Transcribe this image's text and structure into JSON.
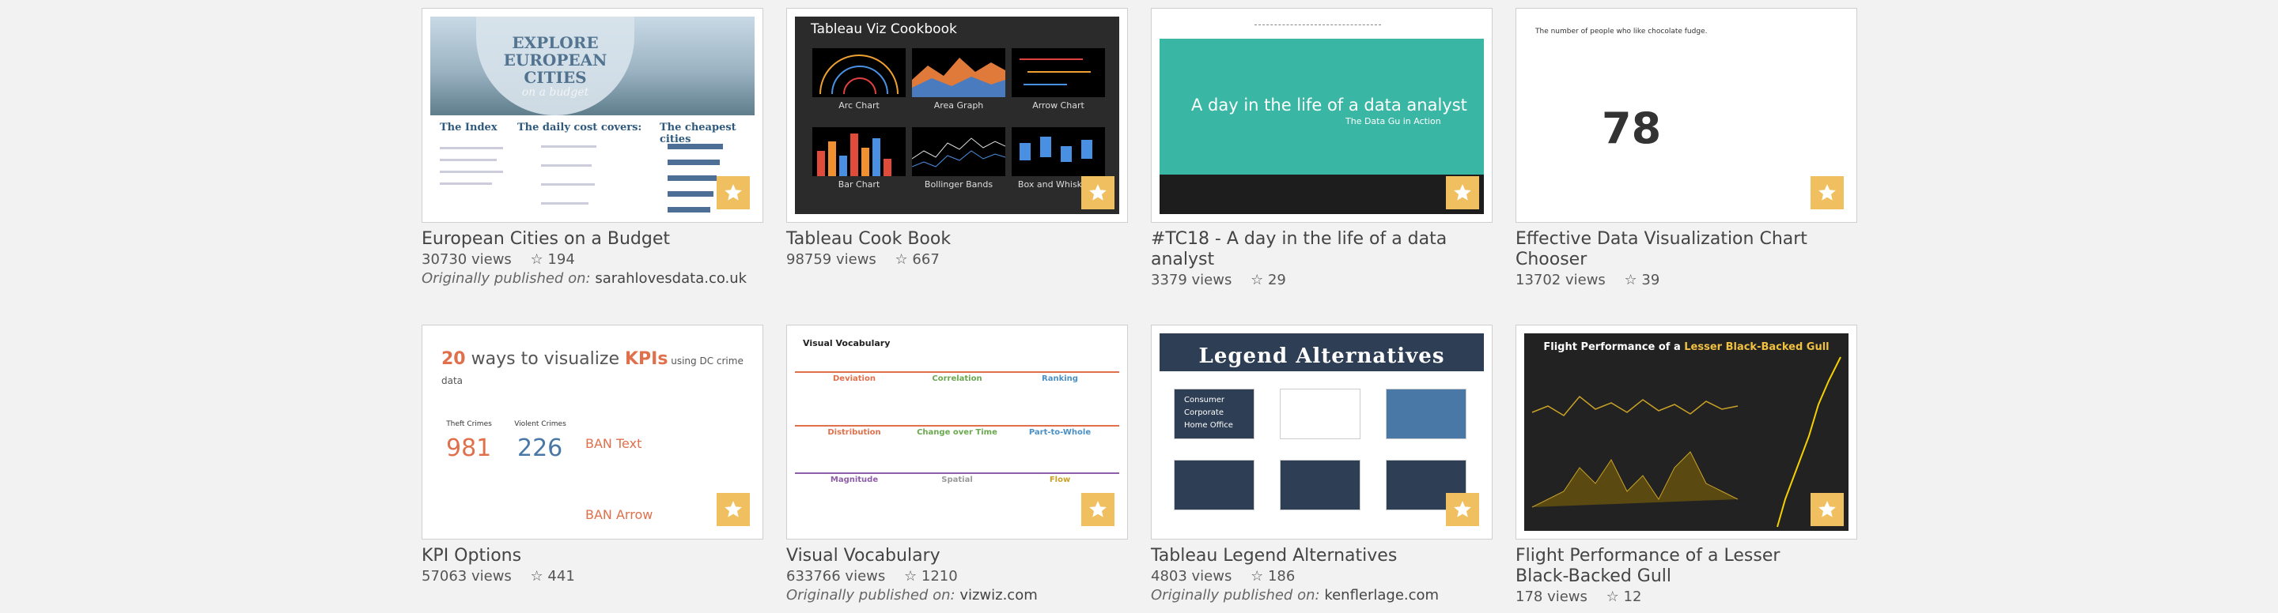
{
  "colors": {
    "background": "#f2f2f2",
    "favorite": "#f0c060"
  },
  "cards": [
    {
      "title": "European Cities on a Budget",
      "views": "30730 views",
      "stars": "194",
      "published_label": "Originally published on:",
      "published_source": "sarahlovesdata.co.uk",
      "thumb": {
        "heading_line1": "EXPLORE",
        "heading_line2": "EUROPEAN",
        "heading_line3": "CITIES",
        "heading_sub": "on a budget",
        "col1": "The Index",
        "col2": "The daily cost covers:",
        "col3": "The cheapest cities"
      }
    },
    {
      "title": "Tableau Cook Book",
      "views": "98759 views",
      "stars": "667",
      "thumb": {
        "heading": "Tableau Viz Cookbook",
        "labels": [
          "Arc Chart",
          "Area Graph",
          "Arrow Chart",
          "Bar Chart",
          "Bollinger Bands",
          "Box and Whisker P"
        ]
      }
    },
    {
      "title": "#TC18 - A day in the life of a data analyst",
      "views": "3379 views",
      "stars": "29",
      "thumb": {
        "heading": "A day in the life of a data analyst",
        "sub": "The Data Gu in Action"
      }
    },
    {
      "title": "Effective Data Visualization Chart Chooser",
      "views": "13702 views",
      "stars": "39",
      "thumb": {
        "caption": "The number of people who like chocolate fudge.",
        "value": "78"
      }
    },
    {
      "title": "KPI Options",
      "views": "57063 views",
      "stars": "441",
      "thumb": {
        "heading_num": "20",
        "heading_mid": " ways to visualize ",
        "heading_kpi": "KPIs",
        "heading_tail": " using DC crime data",
        "n1": "981",
        "n2": "226",
        "label1": "Theft Crimes",
        "label2": "Violent Crimes",
        "ban_text": "BAN Text",
        "ban_arrow": "BAN Arrow"
      }
    },
    {
      "title": "Visual Vocabulary",
      "views": "633766 views",
      "stars": "1210",
      "published_label": "Originally published on:",
      "published_source": "vizwiz.com",
      "thumb": {
        "heading": "Visual Vocabulary",
        "sections": [
          "Deviation",
          "Correlation",
          "Ranking",
          "Distribution",
          "Change over Time",
          "Part-to-Whole",
          "Magnitude",
          "Spatial",
          "Flow"
        ]
      }
    },
    {
      "title": "Tableau Legend Alternatives",
      "views": "4803 views",
      "stars": "186",
      "published_label": "Originally published on:",
      "published_source": "kenflerlage.com",
      "thumb": {
        "heading": "Legend Alternatives",
        "items": [
          "Consumer",
          "Corporate",
          "Home Office"
        ]
      }
    },
    {
      "title": "Flight Performance of a Lesser Black-Backed Gull",
      "views": "178 views",
      "stars": "12",
      "thumb": {
        "heading_a": "Flight Performance of a ",
        "heading_b": "Lesser Black-Backed Gull"
      }
    }
  ]
}
